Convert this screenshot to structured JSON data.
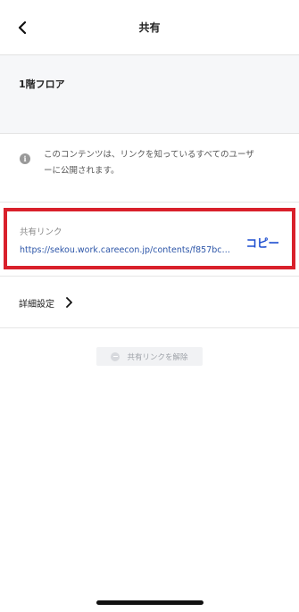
{
  "header": {
    "title": "共有",
    "back_icon": "chevron-left-icon"
  },
  "content": {
    "title": "1階フロア"
  },
  "info": {
    "icon": "info-icon",
    "text_line1": "このコンテンツは、リンクを知っているすべてのユーザ",
    "text_line2": "ーに公開されます。"
  },
  "share_link": {
    "label": "共有リンク",
    "url": "https://sekou.work.careecon.jp/contents/f857bcde…",
    "copy_label": "コピー",
    "highlight_color": "#d9202b",
    "link_color": "#2c55a8"
  },
  "settings": {
    "label": "詳細設定",
    "chevron_icon": "chevron-right-icon"
  },
  "unshare": {
    "label": "共有リンクを解除",
    "icon": "minus-circle-icon"
  }
}
